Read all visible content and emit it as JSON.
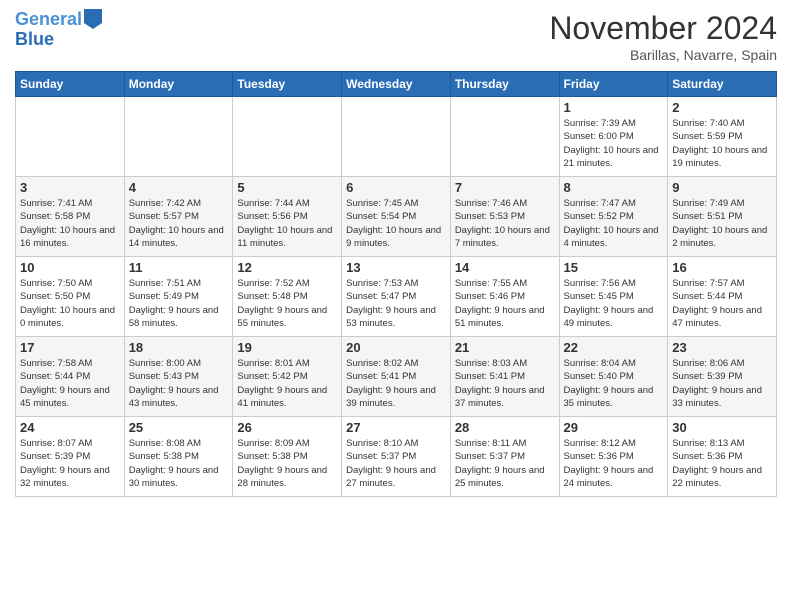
{
  "header": {
    "logo_line1": "General",
    "logo_line2": "Blue",
    "month": "November 2024",
    "location": "Barillas, Navarre, Spain"
  },
  "days_of_week": [
    "Sunday",
    "Monday",
    "Tuesday",
    "Wednesday",
    "Thursday",
    "Friday",
    "Saturday"
  ],
  "weeks": [
    [
      {
        "day": "",
        "info": ""
      },
      {
        "day": "",
        "info": ""
      },
      {
        "day": "",
        "info": ""
      },
      {
        "day": "",
        "info": ""
      },
      {
        "day": "",
        "info": ""
      },
      {
        "day": "1",
        "info": "Sunrise: 7:39 AM\nSunset: 6:00 PM\nDaylight: 10 hours and 21 minutes."
      },
      {
        "day": "2",
        "info": "Sunrise: 7:40 AM\nSunset: 5:59 PM\nDaylight: 10 hours and 19 minutes."
      }
    ],
    [
      {
        "day": "3",
        "info": "Sunrise: 7:41 AM\nSunset: 5:58 PM\nDaylight: 10 hours and 16 minutes."
      },
      {
        "day": "4",
        "info": "Sunrise: 7:42 AM\nSunset: 5:57 PM\nDaylight: 10 hours and 14 minutes."
      },
      {
        "day": "5",
        "info": "Sunrise: 7:44 AM\nSunset: 5:56 PM\nDaylight: 10 hours and 11 minutes."
      },
      {
        "day": "6",
        "info": "Sunrise: 7:45 AM\nSunset: 5:54 PM\nDaylight: 10 hours and 9 minutes."
      },
      {
        "day": "7",
        "info": "Sunrise: 7:46 AM\nSunset: 5:53 PM\nDaylight: 10 hours and 7 minutes."
      },
      {
        "day": "8",
        "info": "Sunrise: 7:47 AM\nSunset: 5:52 PM\nDaylight: 10 hours and 4 minutes."
      },
      {
        "day": "9",
        "info": "Sunrise: 7:49 AM\nSunset: 5:51 PM\nDaylight: 10 hours and 2 minutes."
      }
    ],
    [
      {
        "day": "10",
        "info": "Sunrise: 7:50 AM\nSunset: 5:50 PM\nDaylight: 10 hours and 0 minutes."
      },
      {
        "day": "11",
        "info": "Sunrise: 7:51 AM\nSunset: 5:49 PM\nDaylight: 9 hours and 58 minutes."
      },
      {
        "day": "12",
        "info": "Sunrise: 7:52 AM\nSunset: 5:48 PM\nDaylight: 9 hours and 55 minutes."
      },
      {
        "day": "13",
        "info": "Sunrise: 7:53 AM\nSunset: 5:47 PM\nDaylight: 9 hours and 53 minutes."
      },
      {
        "day": "14",
        "info": "Sunrise: 7:55 AM\nSunset: 5:46 PM\nDaylight: 9 hours and 51 minutes."
      },
      {
        "day": "15",
        "info": "Sunrise: 7:56 AM\nSunset: 5:45 PM\nDaylight: 9 hours and 49 minutes."
      },
      {
        "day": "16",
        "info": "Sunrise: 7:57 AM\nSunset: 5:44 PM\nDaylight: 9 hours and 47 minutes."
      }
    ],
    [
      {
        "day": "17",
        "info": "Sunrise: 7:58 AM\nSunset: 5:44 PM\nDaylight: 9 hours and 45 minutes."
      },
      {
        "day": "18",
        "info": "Sunrise: 8:00 AM\nSunset: 5:43 PM\nDaylight: 9 hours and 43 minutes."
      },
      {
        "day": "19",
        "info": "Sunrise: 8:01 AM\nSunset: 5:42 PM\nDaylight: 9 hours and 41 minutes."
      },
      {
        "day": "20",
        "info": "Sunrise: 8:02 AM\nSunset: 5:41 PM\nDaylight: 9 hours and 39 minutes."
      },
      {
        "day": "21",
        "info": "Sunrise: 8:03 AM\nSunset: 5:41 PM\nDaylight: 9 hours and 37 minutes."
      },
      {
        "day": "22",
        "info": "Sunrise: 8:04 AM\nSunset: 5:40 PM\nDaylight: 9 hours and 35 minutes."
      },
      {
        "day": "23",
        "info": "Sunrise: 8:06 AM\nSunset: 5:39 PM\nDaylight: 9 hours and 33 minutes."
      }
    ],
    [
      {
        "day": "24",
        "info": "Sunrise: 8:07 AM\nSunset: 5:39 PM\nDaylight: 9 hours and 32 minutes."
      },
      {
        "day": "25",
        "info": "Sunrise: 8:08 AM\nSunset: 5:38 PM\nDaylight: 9 hours and 30 minutes."
      },
      {
        "day": "26",
        "info": "Sunrise: 8:09 AM\nSunset: 5:38 PM\nDaylight: 9 hours and 28 minutes."
      },
      {
        "day": "27",
        "info": "Sunrise: 8:10 AM\nSunset: 5:37 PM\nDaylight: 9 hours and 27 minutes."
      },
      {
        "day": "28",
        "info": "Sunrise: 8:11 AM\nSunset: 5:37 PM\nDaylight: 9 hours and 25 minutes."
      },
      {
        "day": "29",
        "info": "Sunrise: 8:12 AM\nSunset: 5:36 PM\nDaylight: 9 hours and 24 minutes."
      },
      {
        "day": "30",
        "info": "Sunrise: 8:13 AM\nSunset: 5:36 PM\nDaylight: 9 hours and 22 minutes."
      }
    ]
  ]
}
